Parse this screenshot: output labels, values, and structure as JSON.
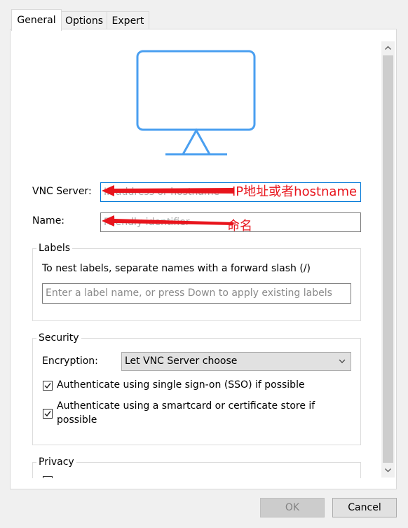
{
  "tabs": [
    {
      "label": "General",
      "active": true
    },
    {
      "label": "Options",
      "active": false
    },
    {
      "label": "Expert",
      "active": false
    }
  ],
  "general": {
    "vnc_server_label": "VNC Server:",
    "vnc_server_placeholder": "IP address or hostname",
    "name_label": "Name:",
    "name_placeholder": "Friendly identifier"
  },
  "labels": {
    "title": "Labels",
    "hint": "To nest labels, separate names with a forward slash (/)",
    "placeholder": "Enter a label name, or press Down to apply existing labels"
  },
  "security": {
    "title": "Security",
    "encryption_label": "Encryption:",
    "encryption_value": "Let VNC Server choose",
    "sso_label": "Authenticate using single sign-on (SSO) if possible",
    "sso_checked": true,
    "smartcard_label_line1": "Authenticate using a smartcard or certificate store if",
    "smartcard_label_line2": "possible",
    "smartcard_checked": true
  },
  "privacy": {
    "title": "Privacy"
  },
  "buttons": {
    "ok": "OK",
    "cancel": "Cancel"
  },
  "annotations": {
    "ip_note": "IP地址或者hostname",
    "name_note": "命名",
    "color": "#e8141c"
  },
  "colors": {
    "monitor_icon": "#4a9ff0",
    "focus_border": "#0078d7"
  }
}
